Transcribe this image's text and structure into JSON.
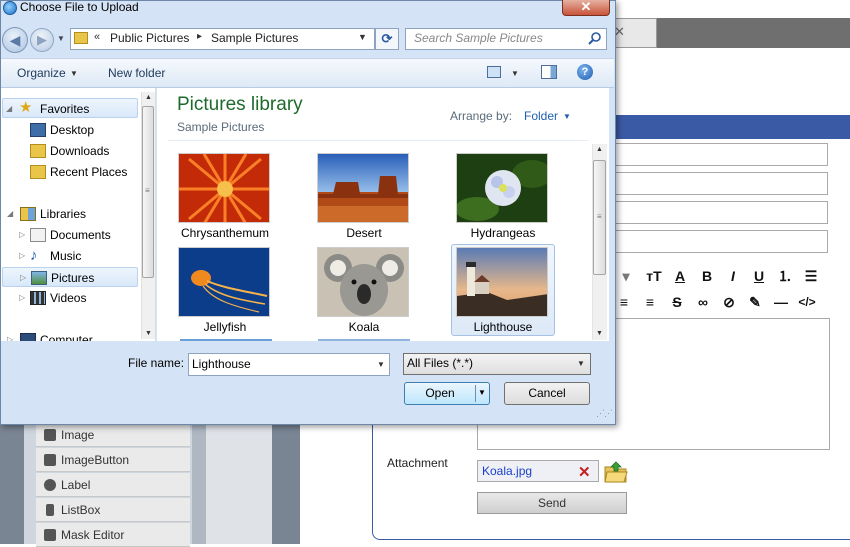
{
  "dialog": {
    "title": "Choose File to Upload",
    "close_symbol": "✕",
    "nav": {
      "back_symbol": "◀",
      "forward_symbol": "▶"
    },
    "address": {
      "chevron": "«",
      "crumbs": [
        "Public Pictures",
        "Sample Pictures"
      ],
      "separator": "▸"
    },
    "refresh_symbol": "⟳",
    "search_placeholder": "Search Sample Pictures",
    "toolbar": {
      "organize": "Organize",
      "new_folder": "New folder",
      "help": "?"
    },
    "nav_pane": {
      "favorites_label": "Favorites",
      "favorites": [
        "Desktop",
        "Downloads",
        "Recent Places"
      ],
      "libraries_label": "Libraries",
      "libraries": [
        "Documents",
        "Music",
        "Pictures",
        "Videos"
      ],
      "computer_label": "Computer"
    },
    "library": {
      "title": "Pictures library",
      "subtitle": "Sample Pictures",
      "arrange_label": "Arrange by:",
      "arrange_value": "Folder"
    },
    "files": [
      {
        "name": "Chrysanthemum",
        "icon": "image-chrysanthemum"
      },
      {
        "name": "Desert",
        "icon": "image-desert"
      },
      {
        "name": "Hydrangeas",
        "icon": "image-hydrangeas"
      },
      {
        "name": "Jellyfish",
        "icon": "image-jellyfish"
      },
      {
        "name": "Koala",
        "icon": "image-koala"
      },
      {
        "name": "Lighthouse",
        "icon": "image-lighthouse",
        "selected": true
      }
    ],
    "file_name_label": "File name:",
    "file_name_value": "Lighthouse",
    "file_type_value": "All Files (*.*)",
    "open_label": "Open",
    "cancel_label": "Cancel"
  },
  "background": {
    "toolbox_items": [
      "Image",
      "ImageButton",
      "Label",
      "ListBox",
      "Mask Editor"
    ],
    "attachment_label": "Attachment",
    "attachment_file": "Koala.jpg",
    "remove_symbol": "✕",
    "send_label": "Send",
    "accent_color": "#3b5aa6"
  }
}
